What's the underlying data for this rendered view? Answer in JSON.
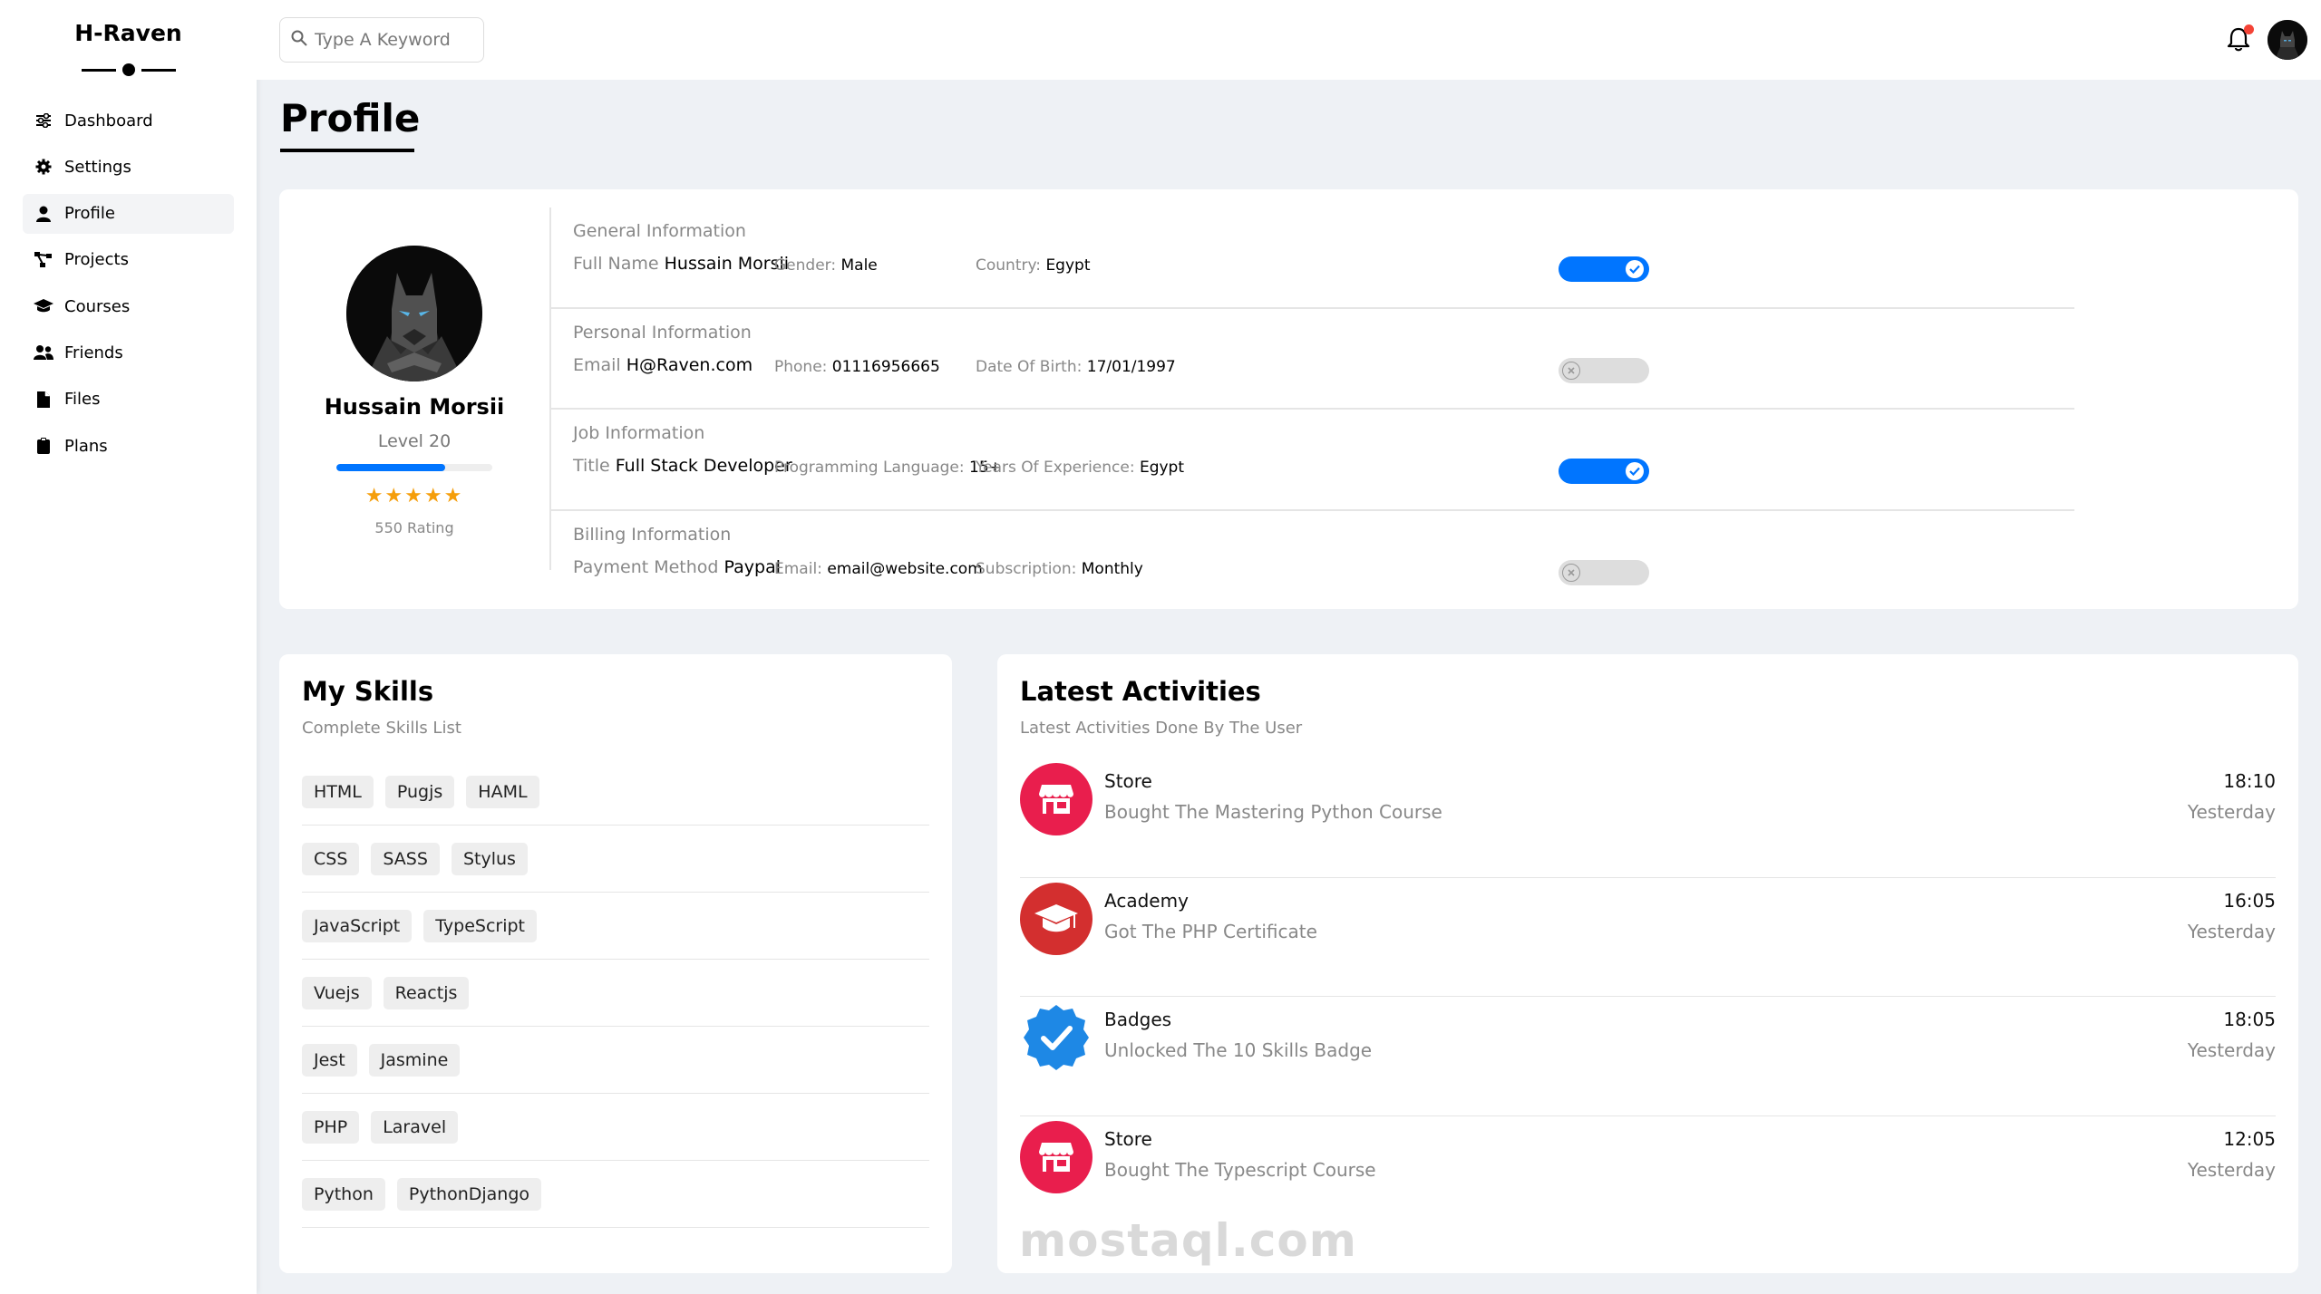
{
  "brand": {
    "name": "H-Raven"
  },
  "sidebar": {
    "items": [
      {
        "label": "Dashboard",
        "icon": "sliders-icon"
      },
      {
        "label": "Settings",
        "icon": "gear-icon"
      },
      {
        "label": "Profile",
        "icon": "user-icon",
        "active": true
      },
      {
        "label": "Projects",
        "icon": "diagram-icon"
      },
      {
        "label": "Courses",
        "icon": "graduation-cap-icon"
      },
      {
        "label": "Friends",
        "icon": "users-icon"
      },
      {
        "label": "Files",
        "icon": "file-icon"
      },
      {
        "label": "Plans",
        "icon": "clipboard-icon"
      }
    ]
  },
  "header": {
    "search_placeholder": "Type A Keyword",
    "has_notification": true
  },
  "page": {
    "title": "Profile"
  },
  "profile": {
    "name": "Hussain Morsii",
    "level": "Level 20",
    "level_progress": 0.7,
    "stars": "★★★★★",
    "rating": "550 Rating",
    "sections": [
      {
        "heading": "General Information",
        "fields": [
          {
            "label": "Full Name",
            "value": "Hussain Morsii"
          },
          {
            "label": "Gender:",
            "value": "Male"
          },
          {
            "label": "Country:",
            "value": "Egypt"
          }
        ],
        "toggle": true
      },
      {
        "heading": "Personal Information",
        "fields": [
          {
            "label": "Email",
            "value": "H@Raven.com"
          },
          {
            "label": "Phone:",
            "value": "01116956665"
          },
          {
            "label": "Date Of Birth:",
            "value": "17/01/1997"
          }
        ],
        "toggle": false
      },
      {
        "heading": "Job Information",
        "fields": [
          {
            "label": "Title",
            "value": "Full Stack Developer"
          },
          {
            "label": "Programming Language:",
            "value": "15+"
          },
          {
            "label": "Years Of Experience:",
            "value": "Egypt"
          }
        ],
        "toggle": true
      },
      {
        "heading": "Billing Information",
        "fields": [
          {
            "label": "Payment Method",
            "value": "Paypal"
          },
          {
            "label": "Email:",
            "value": "email@website.com"
          },
          {
            "label": "Subscription:",
            "value": "Monthly"
          }
        ],
        "toggle": false
      }
    ]
  },
  "skills": {
    "title": "My Skills",
    "subtitle": "Complete Skills List",
    "rows": [
      [
        "HTML",
        "Pugjs",
        "HAML"
      ],
      [
        "CSS",
        "SASS",
        "Stylus"
      ],
      [
        "JavaScript",
        "TypeScript"
      ],
      [
        "Vuejs",
        "Reactjs"
      ],
      [
        "Jest",
        "Jasmine"
      ],
      [
        "PHP",
        "Laravel"
      ],
      [
        "Python",
        "PythonDjango"
      ]
    ]
  },
  "activities": {
    "title": "Latest Activities",
    "subtitle": "Latest Activities Done By The User",
    "items": [
      {
        "name": "Store",
        "desc": "Bought The Mastering Python Course",
        "time": "18:10",
        "date": "Yesterday",
        "icon": "store-icon",
        "color": "#e91e4d"
      },
      {
        "name": "Academy",
        "desc": "Got The PHP Certificate",
        "time": "16:05",
        "date": "Yesterday",
        "icon": "graduation-cap-icon",
        "color": "#d32f2f"
      },
      {
        "name": "Badges",
        "desc": "Unlocked The 10 Skills Badge",
        "time": "18:05",
        "date": "Yesterday",
        "icon": "verified-badge-icon",
        "color": "#1e88e5"
      },
      {
        "name": "Store",
        "desc": "Bought The Typescript Course",
        "time": "12:05",
        "date": "Yesterday",
        "icon": "store-icon",
        "color": "#e91e4d"
      }
    ]
  },
  "watermark": {
    "text": "mostaql.com"
  },
  "colors": {
    "accent": "#0075ff",
    "star": "#f59e0b",
    "background": "#eef1f5"
  }
}
